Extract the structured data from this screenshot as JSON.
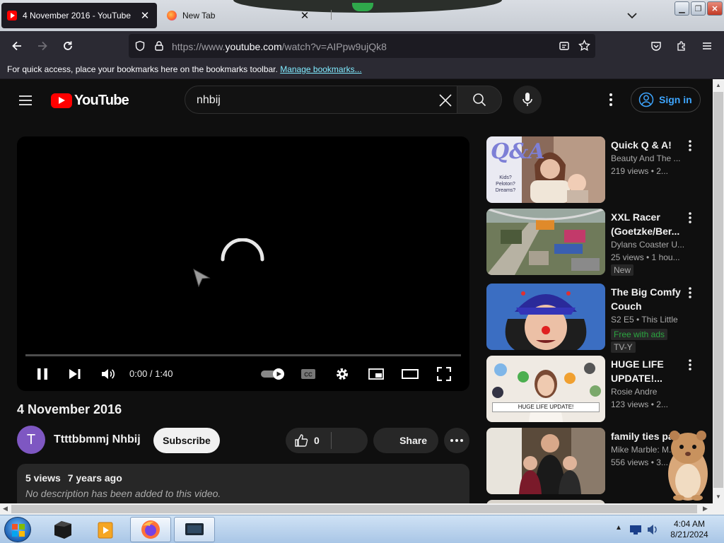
{
  "browser": {
    "tabs": [
      {
        "title": "4 November 2016 - YouTube",
        "active": true
      },
      {
        "title": "New Tab",
        "active": false
      }
    ],
    "url_prefix": "https://www.",
    "url_host": "youtube.com",
    "url_path": "/watch?v=AIPpw9ujQk8",
    "bookmarks_message": "For quick access, place your bookmarks here on the bookmarks toolbar.",
    "bookmarks_link": "Manage bookmarks..."
  },
  "youtube": {
    "logo_text": "YouTube",
    "search_value": "nhbij",
    "sign_in": "Sign in",
    "player": {
      "time": "0:00 / 1:40",
      "progress_fraction": 0.0
    },
    "video": {
      "title": "4 November 2016",
      "channel": "Ttttbbmmj Nhbij",
      "avatar_letter": "T",
      "subscribe": "Subscribe",
      "likes": "0",
      "share": "Share",
      "views": "5 views",
      "age": "7 years ago",
      "description": "No description has been added to this video."
    },
    "recommendations": [
      {
        "title": "Quick Q & A!",
        "channel": "Beauty And The ...",
        "meta": "219 views • 2...",
        "badges": []
      },
      {
        "title": "XXL Racer (Goetzke/Ber...",
        "channel": "Dylans Coaster U...",
        "meta": "25 views • 1 hou...",
        "badges": [
          "New"
        ]
      },
      {
        "title": "The Big Comfy Couch",
        "channel": "S2 E5 • This Little",
        "meta": "",
        "badges": [
          "Free with ads",
          "TV-Y"
        ]
      },
      {
        "title": "HUGE LIFE UPDATE!...",
        "channel": "Rosie Andre",
        "meta": "123 views • 2...",
        "badges": [],
        "thumb_caption": "HUGE LIFE UPDATE!"
      },
      {
        "title": "family ties part 2",
        "channel": "Mike Marble: M...",
        "meta": "556 views • 3...",
        "badges": []
      }
    ],
    "qa_thumb_text": {
      "big": "Q&A",
      "small": "Kids? Peloton? Dreams?"
    }
  },
  "taskbar": {
    "time": "4:04 AM",
    "date": "8/21/2024"
  },
  "colors": {
    "yt_bg": "#0f0f0f",
    "yt_red": "#ff0000",
    "link_blue": "#3ea6ff",
    "free_green": "#2ba640"
  }
}
